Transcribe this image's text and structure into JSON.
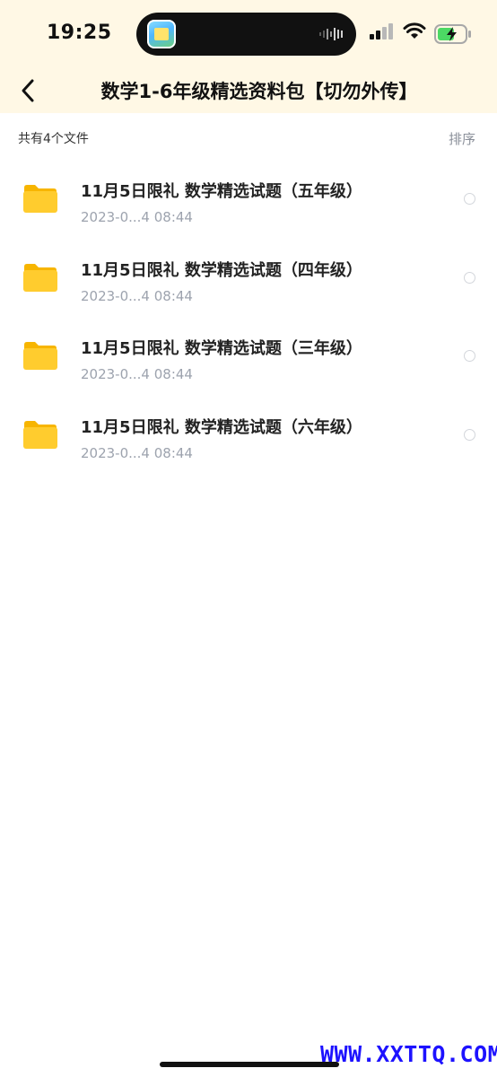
{
  "status": {
    "time": "19:25"
  },
  "nav": {
    "title": "数学1-6年级精选资料包【切勿外传】"
  },
  "summary": {
    "count_text": "共有4个文件",
    "sort_label": "排序"
  },
  "files": [
    {
      "name": "11月5日限礼 数学精选试题（五年级）",
      "date": "2023-0...4 08:44"
    },
    {
      "name": "11月5日限礼 数学精选试题（四年级）",
      "date": "2023-0...4 08:44"
    },
    {
      "name": "11月5日限礼 数学精选试题（三年级）",
      "date": "2023-0...4 08:44"
    },
    {
      "name": "11月5日限礼 数学精选试题（六年级）",
      "date": "2023-0...4 08:44"
    }
  ],
  "watermark": "WWW.XXTTQ.COM",
  "colors": {
    "header_bg": "#fff8e5",
    "folder": "#ffcc2e",
    "watermark": "#1d12ff"
  }
}
